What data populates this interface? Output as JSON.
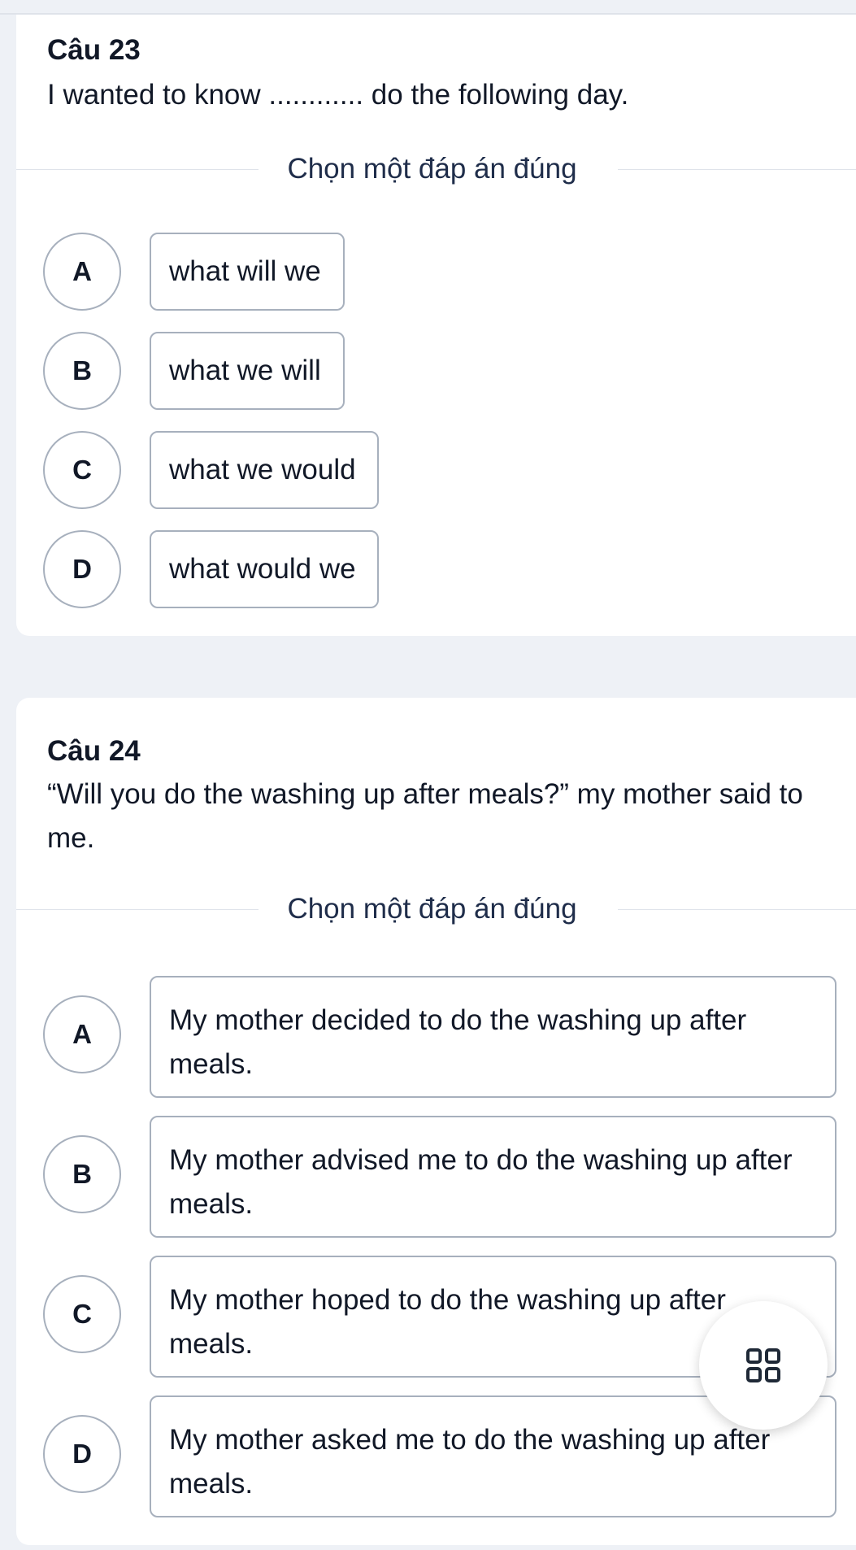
{
  "questions": [
    {
      "title": "Câu 23",
      "text": "I wanted to know ............ do the following day.",
      "instruction": "Chọn một đáp án đúng",
      "options": [
        {
          "letter": "A",
          "text": "what will we"
        },
        {
          "letter": "B",
          "text": "what we will"
        },
        {
          "letter": "C",
          "text": "what we would"
        },
        {
          "letter": "D",
          "text": "what would we"
        }
      ]
    },
    {
      "title": "Câu 24",
      "text": "“Will you do the washing up after meals?” my mother said to me.",
      "instruction": "Chọn một đáp án đúng",
      "options": [
        {
          "letter": "A",
          "text": "My mother decided to do the washing up after meals."
        },
        {
          "letter": "B",
          "text": "My mother advised me to do the washing up after meals."
        },
        {
          "letter": "C",
          "text": "My mother hoped to do the washing up after meals."
        },
        {
          "letter": "D",
          "text": "My mother asked me to do the washing up after meals."
        }
      ]
    }
  ],
  "fab": {
    "icon": "grid-icon"
  },
  "colors": {
    "background": "#eef1f6",
    "card": "#ffffff",
    "border": "#a7b0bd",
    "text": "#111827",
    "instruction": "#1f2d4a"
  }
}
